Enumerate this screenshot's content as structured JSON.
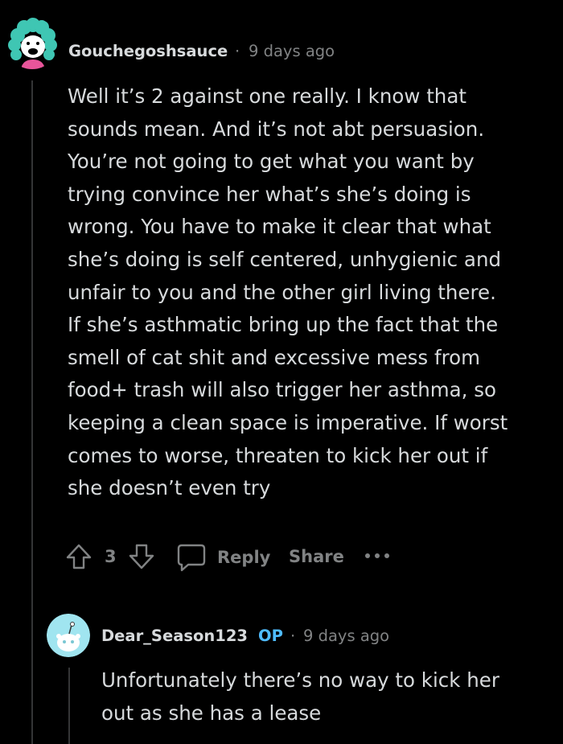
{
  "comment": {
    "author": "Gouchegoshsauce",
    "separator": "·",
    "timestamp": "9 days ago",
    "body_lines": [
      "Well it’s 2 against one really. I know that",
      "sounds mean. And it’s not abt persuasion.",
      "You’re not going to get what you want by",
      "trying convince her what’s she’s doing is",
      "wrong. You have to make it clear that what",
      "she’s doing is self centered, unhygienic and",
      "unfair to you and the other girl living there.",
      "If she’s asthmatic bring up the fact that the",
      "smell of cat shit and excessive mess from",
      "food+ trash will also trigger her asthma, so",
      "keeping a clean space is imperative. If worst",
      "comes to worse, threaten to kick her out if",
      "she doesn’t even try"
    ],
    "actions": {
      "upvote_icon": "arrow-up-icon",
      "score": "3",
      "downvote_icon": "arrow-down-icon",
      "reply_icon": "speech-bubble-icon",
      "reply_label": "Reply",
      "share_label": "Share",
      "more_icon": "more-dots-icon"
    }
  },
  "reply": {
    "author": "Dear_Season123",
    "op_badge": "OP",
    "separator": "·",
    "timestamp": "9 days ago",
    "body_lines": [
      "Unfortunately there’s no way to kick her",
      "out as she has a lease"
    ]
  },
  "colors": {
    "background": "#000000",
    "text": "#d7dadc",
    "meta": "#818384",
    "op": "#4fbcff",
    "thread_line": "#343536"
  }
}
